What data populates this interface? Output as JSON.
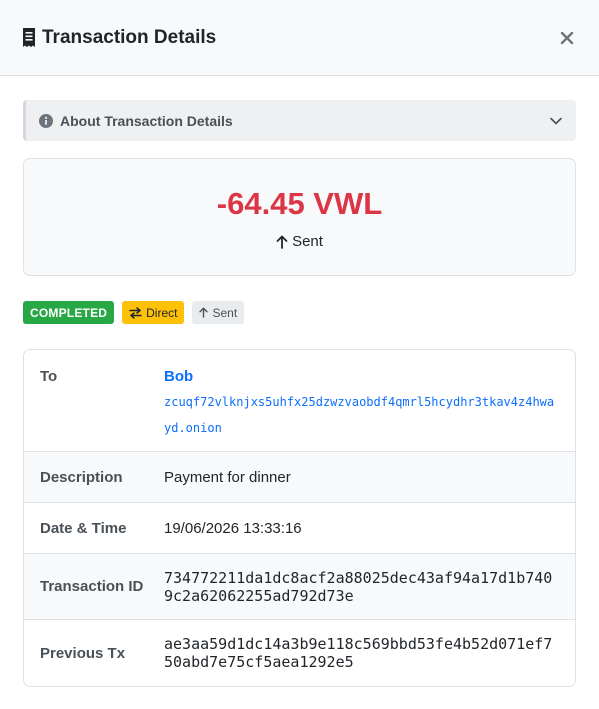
{
  "header": {
    "title": "Transaction Details"
  },
  "accordion": {
    "label": "About Transaction Details"
  },
  "summary": {
    "amount": "-64.45 VWL",
    "direction": "Sent"
  },
  "badges": {
    "status": "COMPLETED",
    "type": "Direct",
    "direction": "Sent"
  },
  "details": {
    "to_label": "To",
    "to_name": "Bob",
    "to_address": "zcuqf72vlknjxs5uhfx25dzwzvaobdf4qmrl5hcydhr3tkav4z4hwayd.onion",
    "description_label": "Description",
    "description": "Payment for dinner",
    "datetime_label": "Date & Time",
    "datetime": "19/06/2026 13:33:16",
    "txid_label": "Transaction ID",
    "txid": "734772211da1dc8acf2a88025dec43af94a17d1b7409c2a62062255ad792d73e",
    "prev_label": "Previous Tx",
    "prev_tx": "ae3aa59d1dc14a3b9e118c569bbd53fe4b52d071ef750abd7e75cf5aea1292e5"
  },
  "colors": {
    "negative": "#dc3545",
    "link": "#0d6efd",
    "success": "#28a745",
    "warning": "#ffc107"
  }
}
